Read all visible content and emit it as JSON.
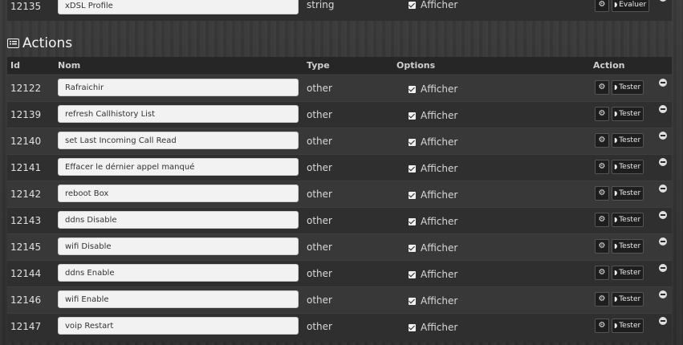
{
  "info_row": {
    "id": "12135",
    "name": "xDSL Profile",
    "type": "string",
    "option": "Afficher",
    "evaluate_label": "Evaluer"
  },
  "section": {
    "title": "Actions",
    "icon": "list-icon"
  },
  "columns": {
    "id": "Id",
    "name": "Nom",
    "type": "Type",
    "options": "Options",
    "action": "Action"
  },
  "rows": [
    {
      "id": "12122",
      "name": "Rafraichir",
      "type": "other",
      "option": "Afficher",
      "test": "Tester"
    },
    {
      "id": "12139",
      "name": "refresh Callhistory List",
      "type": "other",
      "option": "Afficher",
      "test": "Tester"
    },
    {
      "id": "12140",
      "name": "set Last Incoming Call Read",
      "type": "other",
      "option": "Afficher",
      "test": "Tester"
    },
    {
      "id": "12141",
      "name": "Effacer le dérnier appel manqué",
      "type": "other",
      "option": "Afficher",
      "test": "Tester"
    },
    {
      "id": "12142",
      "name": "reboot Box",
      "type": "other",
      "option": "Afficher",
      "test": "Tester"
    },
    {
      "id": "12143",
      "name": "ddns Disable",
      "type": "other",
      "option": "Afficher",
      "test": "Tester"
    },
    {
      "id": "12145",
      "name": "wifi Disable",
      "type": "other",
      "option": "Afficher",
      "test": "Tester"
    },
    {
      "id": "12144",
      "name": "ddns Enable",
      "type": "other",
      "option": "Afficher",
      "test": "Tester"
    },
    {
      "id": "12146",
      "name": "wifi Enable",
      "type": "other",
      "option": "Afficher",
      "test": "Tester"
    },
    {
      "id": "12147",
      "name": "voip Restart",
      "type": "other",
      "option": "Afficher",
      "test": "Tester"
    }
  ]
}
